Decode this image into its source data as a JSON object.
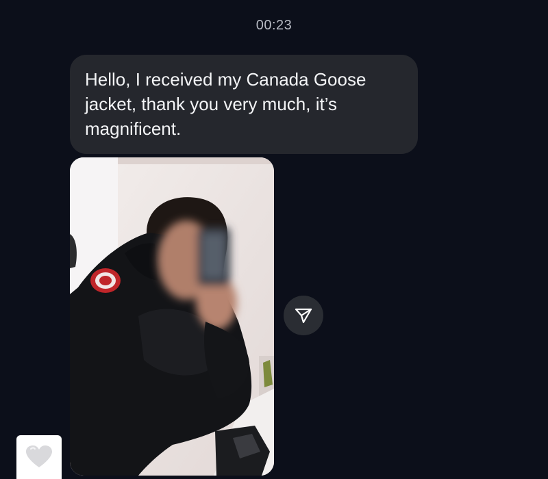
{
  "conversation": {
    "timestamp": "00:23",
    "message": {
      "text": "Hello, I received my Canada Goose jacket, thank you very much, it’s magnificent."
    },
    "photo": {
      "subject": "mirror-selfie",
      "colors": {
        "wall": "#ece6e4",
        "jacket": "#131417",
        "badge": "#c0262a"
      }
    },
    "actions": {
      "share_icon": "paper-plane-icon",
      "reaction_icon": "heart-icon"
    }
  }
}
